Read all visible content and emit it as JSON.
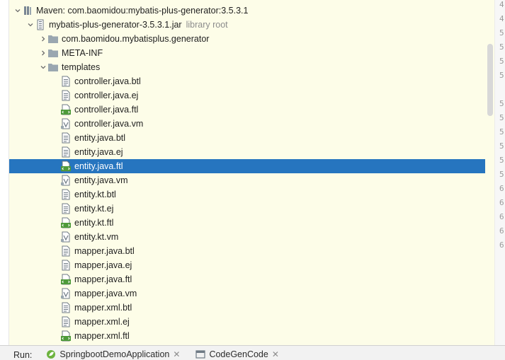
{
  "tree": {
    "rows": [
      {
        "label": "Maven: com.baomidou:mybatis-plus-generator:3.5.3.1",
        "hint": "",
        "icon": "maven-library-icon",
        "arrow": "expanded",
        "indent": 0
      },
      {
        "label": "mybatis-plus-generator-3.5.3.1.jar",
        "hint": "library root",
        "icon": "jar-icon",
        "arrow": "expanded",
        "indent": 1
      },
      {
        "label": "com.baomidou.mybatisplus.generator",
        "hint": "",
        "icon": "folder-icon",
        "arrow": "collapsed",
        "indent": 2
      },
      {
        "label": "META-INF",
        "hint": "",
        "icon": "folder-icon",
        "arrow": "collapsed",
        "indent": 2
      },
      {
        "label": "templates",
        "hint": "",
        "icon": "folder-icon",
        "arrow": "expanded",
        "indent": 2
      },
      {
        "label": "controller.java.btl",
        "hint": "",
        "icon": "text-file-icon",
        "arrow": "none",
        "indent": 3
      },
      {
        "label": "controller.java.ej",
        "hint": "",
        "icon": "text-file-icon",
        "arrow": "none",
        "indent": 3
      },
      {
        "label": "controller.java.ftl",
        "hint": "",
        "icon": "freemarker-file-icon",
        "arrow": "none",
        "indent": 3
      },
      {
        "label": "controller.java.vm",
        "hint": "",
        "icon": "velocity-file-icon",
        "arrow": "none",
        "indent": 3
      },
      {
        "label": "entity.java.btl",
        "hint": "",
        "icon": "text-file-icon",
        "arrow": "none",
        "indent": 3
      },
      {
        "label": "entity.java.ej",
        "hint": "",
        "icon": "text-file-icon",
        "arrow": "none",
        "indent": 3
      },
      {
        "label": "entity.java.ftl",
        "hint": "",
        "icon": "freemarker-file-icon",
        "arrow": "none",
        "indent": 3,
        "selected": true
      },
      {
        "label": "entity.java.vm",
        "hint": "",
        "icon": "velocity-file-icon",
        "arrow": "none",
        "indent": 3
      },
      {
        "label": "entity.kt.btl",
        "hint": "",
        "icon": "text-file-icon",
        "arrow": "none",
        "indent": 3
      },
      {
        "label": "entity.kt.ej",
        "hint": "",
        "icon": "text-file-icon",
        "arrow": "none",
        "indent": 3
      },
      {
        "label": "entity.kt.ftl",
        "hint": "",
        "icon": "freemarker-file-icon",
        "arrow": "none",
        "indent": 3
      },
      {
        "label": "entity.kt.vm",
        "hint": "",
        "icon": "velocity-file-icon",
        "arrow": "none",
        "indent": 3
      },
      {
        "label": "mapper.java.btl",
        "hint": "",
        "icon": "text-file-icon",
        "arrow": "none",
        "indent": 3
      },
      {
        "label": "mapper.java.ej",
        "hint": "",
        "icon": "text-file-icon",
        "arrow": "none",
        "indent": 3
      },
      {
        "label": "mapper.java.ftl",
        "hint": "",
        "icon": "freemarker-file-icon",
        "arrow": "none",
        "indent": 3
      },
      {
        "label": "mapper.java.vm",
        "hint": "",
        "icon": "velocity-file-icon",
        "arrow": "none",
        "indent": 3
      },
      {
        "label": "mapper.xml.btl",
        "hint": "",
        "icon": "text-file-icon",
        "arrow": "none",
        "indent": 3
      },
      {
        "label": "mapper.xml.ej",
        "hint": "",
        "icon": "text-file-icon",
        "arrow": "none",
        "indent": 3
      },
      {
        "label": "mapper.xml.ftl",
        "hint": "",
        "icon": "freemarker-file-icon",
        "arrow": "none",
        "indent": 3
      }
    ]
  },
  "gutter": {
    "line_numbers": [
      "4",
      "4",
      "5",
      "5",
      "5",
      "5",
      "",
      "5",
      "5",
      "5",
      "5",
      "5",
      "5",
      "6",
      "6",
      "6",
      "6",
      "6"
    ]
  },
  "run_bar": {
    "label": "Run:",
    "tabs": [
      {
        "label": "SpringbootDemoApplication",
        "icon": "spring-boot-icon"
      },
      {
        "label": "CodeGenCode",
        "icon": "application-icon"
      }
    ]
  },
  "colors": {
    "tree_background": "#fdfde8",
    "selection": "#2675bf",
    "folder": "#9aa7b0",
    "freemarker_green": "#4e9a3a"
  }
}
